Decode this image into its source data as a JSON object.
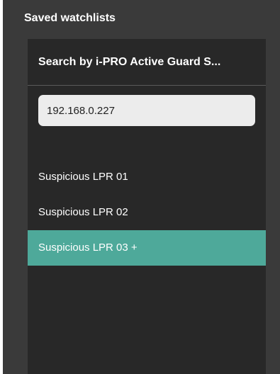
{
  "panel": {
    "title": "Saved watchlists"
  },
  "watchlist_panel": {
    "header": "Search by i-PRO Active Guard S...",
    "search": {
      "value": "192.168.0.227"
    },
    "items": [
      {
        "label": "Suspicious LPR 01",
        "selected": false
      },
      {
        "label": "Suspicious LPR 02",
        "selected": false
      },
      {
        "label": "Suspicious LPR 03 +",
        "selected": true
      }
    ]
  },
  "colors": {
    "outer_background": "#3a3a3a",
    "inner_background": "#282828",
    "selected_item": "#4ea99a",
    "text": "#ffffff",
    "search_field": "#ececec"
  }
}
